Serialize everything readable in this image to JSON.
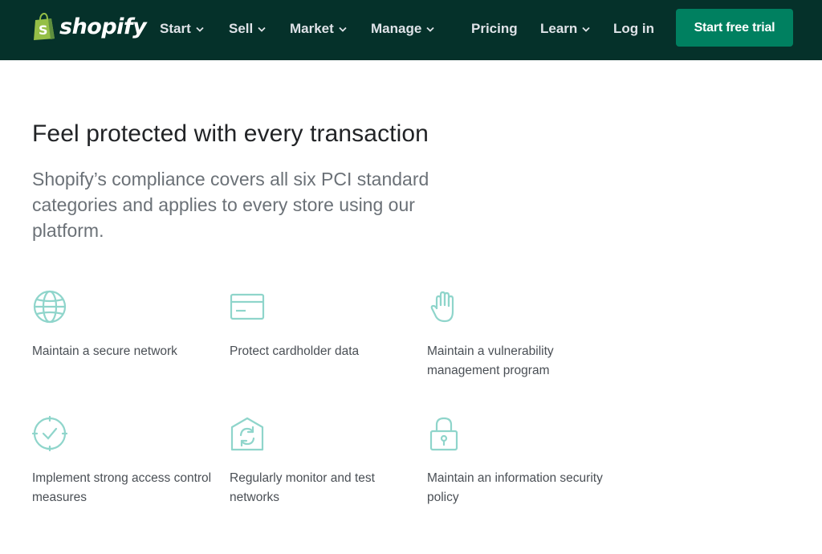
{
  "nav": {
    "brand": "shopify",
    "items": [
      {
        "label": "Start",
        "has_dropdown": true
      },
      {
        "label": "Sell",
        "has_dropdown": true
      },
      {
        "label": "Market",
        "has_dropdown": true
      },
      {
        "label": "Manage",
        "has_dropdown": true
      },
      {
        "label": "Pricing",
        "has_dropdown": false
      },
      {
        "label": "Learn",
        "has_dropdown": true
      },
      {
        "label": "Log in",
        "has_dropdown": false
      }
    ],
    "cta": "Start free trial"
  },
  "hero": {
    "headline": "Feel protected with every transaction",
    "lead": "Shopify’s compliance covers all six PCI standard categories and applies to every store using our platform."
  },
  "features": [
    {
      "icon": "globe-icon",
      "label": "Maintain a secure network"
    },
    {
      "icon": "credit-card-icon",
      "label": "Protect cardholder data"
    },
    {
      "icon": "hand-icon",
      "label": "Maintain a vulnerability management program"
    },
    {
      "icon": "check-circle-icon",
      "label": "Implement strong access control measures"
    },
    {
      "icon": "refresh-shield-icon",
      "label": "Regularly monitor and test networks"
    },
    {
      "icon": "lock-icon",
      "label": "Maintain an information security policy"
    }
  ],
  "colors": {
    "nav_bg": "#05312a",
    "cta_bg": "#008060",
    "icon_teal": "#8fd5cb"
  }
}
